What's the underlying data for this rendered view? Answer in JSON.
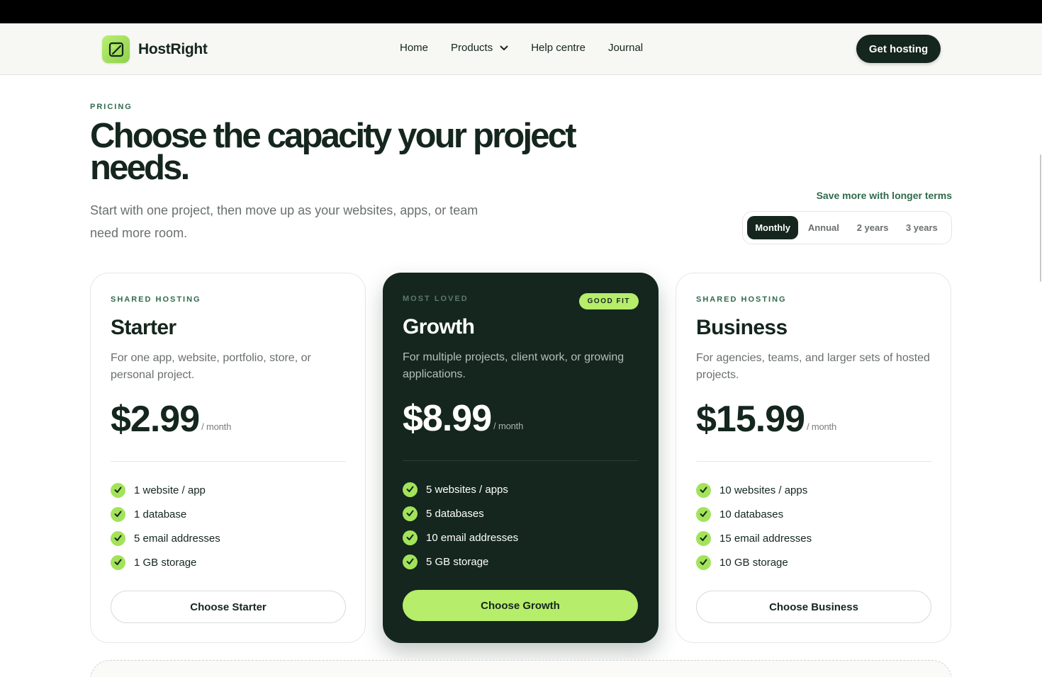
{
  "brand": {
    "name": "HostRight",
    "accent": "#b6ed6a",
    "dark": "#14261e"
  },
  "nav": {
    "items": [
      {
        "label": "Home"
      },
      {
        "label": "Products",
        "icon": "chevron-down-icon"
      },
      {
        "label": "Help centre"
      },
      {
        "label": "Journal"
      }
    ],
    "cta_label": "Get hosting"
  },
  "hero": {
    "eyebrow": "PRICING",
    "title": "Choose the capacity your project needs.",
    "subtitle": "Start with one project, then move up as your websites, apps, or team need more room."
  },
  "billing": {
    "note": "Save more with longer terms",
    "terms": [
      "Monthly",
      "Annual",
      "2 years",
      "3 years"
    ],
    "selected": "Monthly"
  },
  "plans": [
    {
      "eyebrow": "SHARED HOSTING",
      "name": "Starter",
      "description": "For one app, website, portfolio, store, or personal project.",
      "price": "$2.99",
      "period": "/ month",
      "features": [
        "1 website / app",
        "1 database",
        "5 email addresses",
        "1 GB storage"
      ],
      "cta": "Choose Starter"
    },
    {
      "eyebrow": "MOST LOVED",
      "badge": "GOOD FIT",
      "name": "Growth",
      "description": "For multiple projects, client work, or growing applications.",
      "price": "$8.99",
      "period": "/ month",
      "features": [
        "5 websites / apps",
        "5 databases",
        "10 email addresses",
        "5 GB storage"
      ],
      "cta": "Choose Growth"
    },
    {
      "eyebrow": "SHARED HOSTING",
      "name": "Business",
      "description": "For agencies, teams, and larger sets of hosted projects.",
      "price": "$15.99",
      "period": "/ month",
      "features": [
        "10 websites / apps",
        "10 databases",
        "15 email addresses",
        "10 GB storage"
      ],
      "cta": "Choose Business"
    }
  ]
}
